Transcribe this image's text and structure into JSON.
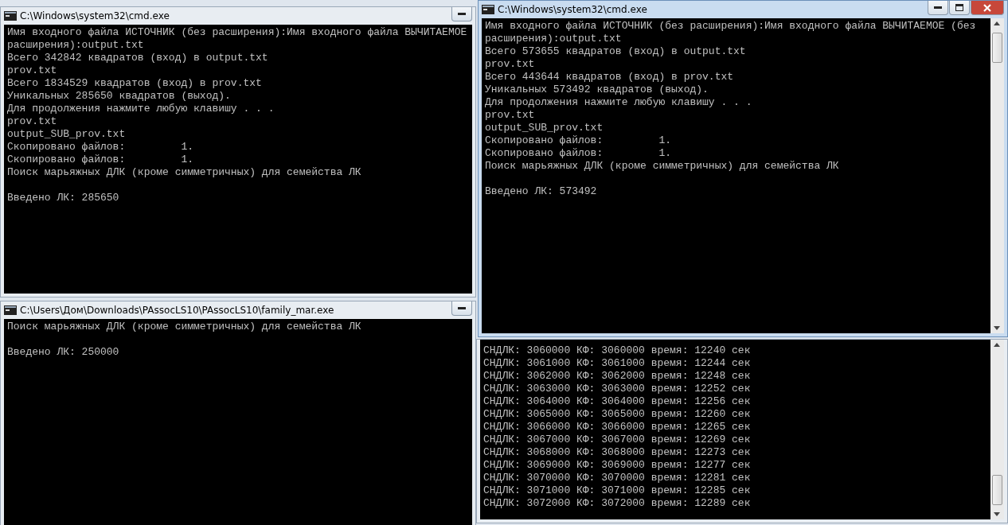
{
  "windows": [
    {
      "kind": "titled",
      "title": "C:\\Windows\\system32\\cmd.exe",
      "active": false,
      "title_buttons": [
        {
          "kind": "minimize"
        }
      ],
      "scrollbar": false,
      "blocks": [
        [
          "Имя входного файла ИСТОЧНИК (без расширения):Имя входного файла ВЫЧИТАЕМОЕ",
          "расширения):output.txt",
          "Всего 342842 квадратов (вход) в output.txt",
          "prov.txt",
          "Всего 1834529 квадратов (вход) в prov.txt",
          "Уникальных 285650 квадратов (выход).",
          "Для продолжения нажмите любую клавишу . . .",
          "prov.txt",
          "output_SUB_prov.txt",
          "Скопировано файлов:         1.",
          "Скопировано файлов:         1.",
          "Поиск марьяжных ДЛК (кроме симметричных) для семейства ЛК"
        ],
        [
          "Введено ЛК: 285650"
        ]
      ]
    },
    {
      "kind": "titled",
      "title": "C:\\Windows\\system32\\cmd.exe",
      "active": true,
      "title_buttons": [
        {
          "kind": "minimize"
        },
        {
          "kind": "maximize"
        },
        {
          "kind": "close"
        }
      ],
      "scrollbar": true,
      "blocks": [
        [
          "Имя входного файла ИСТОЧНИК (без расширения):Имя входного файла ВЫЧИТАЕМОЕ (без",
          "расширения):output.txt",
          "Всего 573655 квадратов (вход) в output.txt",
          "prov.txt",
          "Всего 443644 квадратов (вход) в prov.txt",
          "Уникальных 573492 квадратов (выход).",
          "Для продолжения нажмите любую клавишу . . .",
          "prov.txt",
          "output_SUB_prov.txt",
          "Скопировано файлов:         1.",
          "Скопировано файлов:         1.",
          "Поиск марьяжных ДЛК (кроме симметричных) для семейства ЛК"
        ],
        [
          "Введено ЛК: 573492"
        ]
      ]
    },
    {
      "kind": "titled",
      "title": "C:\\Users\\Дом\\Downloads\\PAssocLS10\\PAssocLS10\\family_mar.exe",
      "active": false,
      "title_buttons": [
        {
          "kind": "minimize"
        }
      ],
      "scrollbar": false,
      "blocks": [
        [
          "Поиск марьяжных ДЛК (кроме симметричных) для семейства ЛК"
        ],
        [
          "Введено ЛК: 250000"
        ]
      ]
    },
    {
      "kind": "covered",
      "active": false,
      "scrollbar": true,
      "blocks": [
        [
          "СНДЛК: 3060000 КФ: 3060000 время: 12240 сек",
          "СНДЛК: 3061000 КФ: 3061000 время: 12244 сек",
          "СНДЛК: 3062000 КФ: 3062000 время: 12248 сек",
          "СНДЛК: 3063000 КФ: 3063000 время: 12252 сек",
          "СНДЛК: 3064000 КФ: 3064000 время: 12256 сек",
          "СНДЛК: 3065000 КФ: 3065000 время: 12260 сек",
          "СНДЛК: 3066000 КФ: 3066000 время: 12265 сек",
          "СНДЛК: 3067000 КФ: 3067000 время: 12269 сек",
          "СНДЛК: 3068000 КФ: 3068000 время: 12273 сек",
          "СНДЛК: 3069000 КФ: 3069000 время: 12277 сек",
          "СНДЛК: 3070000 КФ: 3070000 время: 12281 сек",
          "СНДЛК: 3071000 КФ: 3071000 время: 12285 сек",
          "СНДЛК: 3072000 КФ: 3072000 время: 12289 сек"
        ]
      ]
    }
  ]
}
